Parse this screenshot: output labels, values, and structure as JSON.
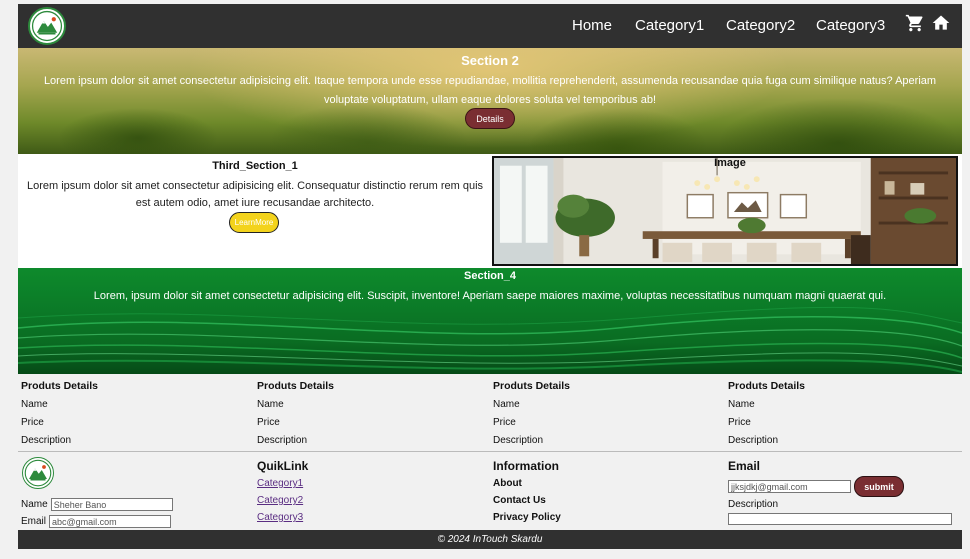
{
  "nav": {
    "links": [
      "Home",
      "Category1",
      "Category2",
      "Category3"
    ],
    "icons": [
      "shopping-cart-icon",
      "home-icon"
    ]
  },
  "section2": {
    "title": "Section 2",
    "text": "Lorem ipsum dolor sit amet consectetur adipisicing elit. Itaque tempora unde esse repudiandae, mollitia reprehenderit, assumenda recusandae quia fuga cum similique natus? Aperiam voluptate voluptatum, ullam eaque dolores soluta vel temporibus ab!",
    "button": "Details"
  },
  "section3": {
    "title": "Third_Section_1",
    "text": "Lorem ipsum dolor sit amet consectetur adipisicing elit. Consequatur distinctio rerum rem quis est autem odio, amet iure recusandae architecto.",
    "button": "LearnMore",
    "image_label": "Image"
  },
  "section4": {
    "title": "Section_4",
    "text": "Lorem, ipsum dolor sit amet consectetur adipisicing elit. Suscipit, inventore! Aperiam saepe maiores maxime, voluptas necessitatibus numquam magni quaerat qui."
  },
  "products": [
    {
      "heading": "Produts Details",
      "name": "Name",
      "price": "Price",
      "description": "Description"
    },
    {
      "heading": "Produts Details",
      "name": "Name",
      "price": "Price",
      "description": "Description"
    },
    {
      "heading": "Produts Details",
      "name": "Name",
      "price": "Price",
      "description": "Description"
    },
    {
      "heading": "Produts Details",
      "name": "Name",
      "price": "Price",
      "description": "Description"
    }
  ],
  "footer": {
    "name_label": "Name",
    "name_value": "Sheher Bano",
    "email_label": "Email",
    "email_value": "abc@gmail.com",
    "quicklink_title": "QuikLink",
    "quicklinks": [
      "Category1",
      "Category2",
      "Category3"
    ],
    "info_title": "Information",
    "info_items": [
      "About",
      "Contact Us",
      "Privacy Policy"
    ],
    "email_title": "Email",
    "email_input_value": "jjksjdkj@gmail.com",
    "submit_label": "submit",
    "description_label": "Description",
    "copyright": "© 2024 InTouch Skardu"
  },
  "colors": {
    "navbar": "#303030",
    "button_dark_red": "#7a2e32",
    "button_yellow": "#f3d31c",
    "section4_green": "#0b7a27"
  }
}
